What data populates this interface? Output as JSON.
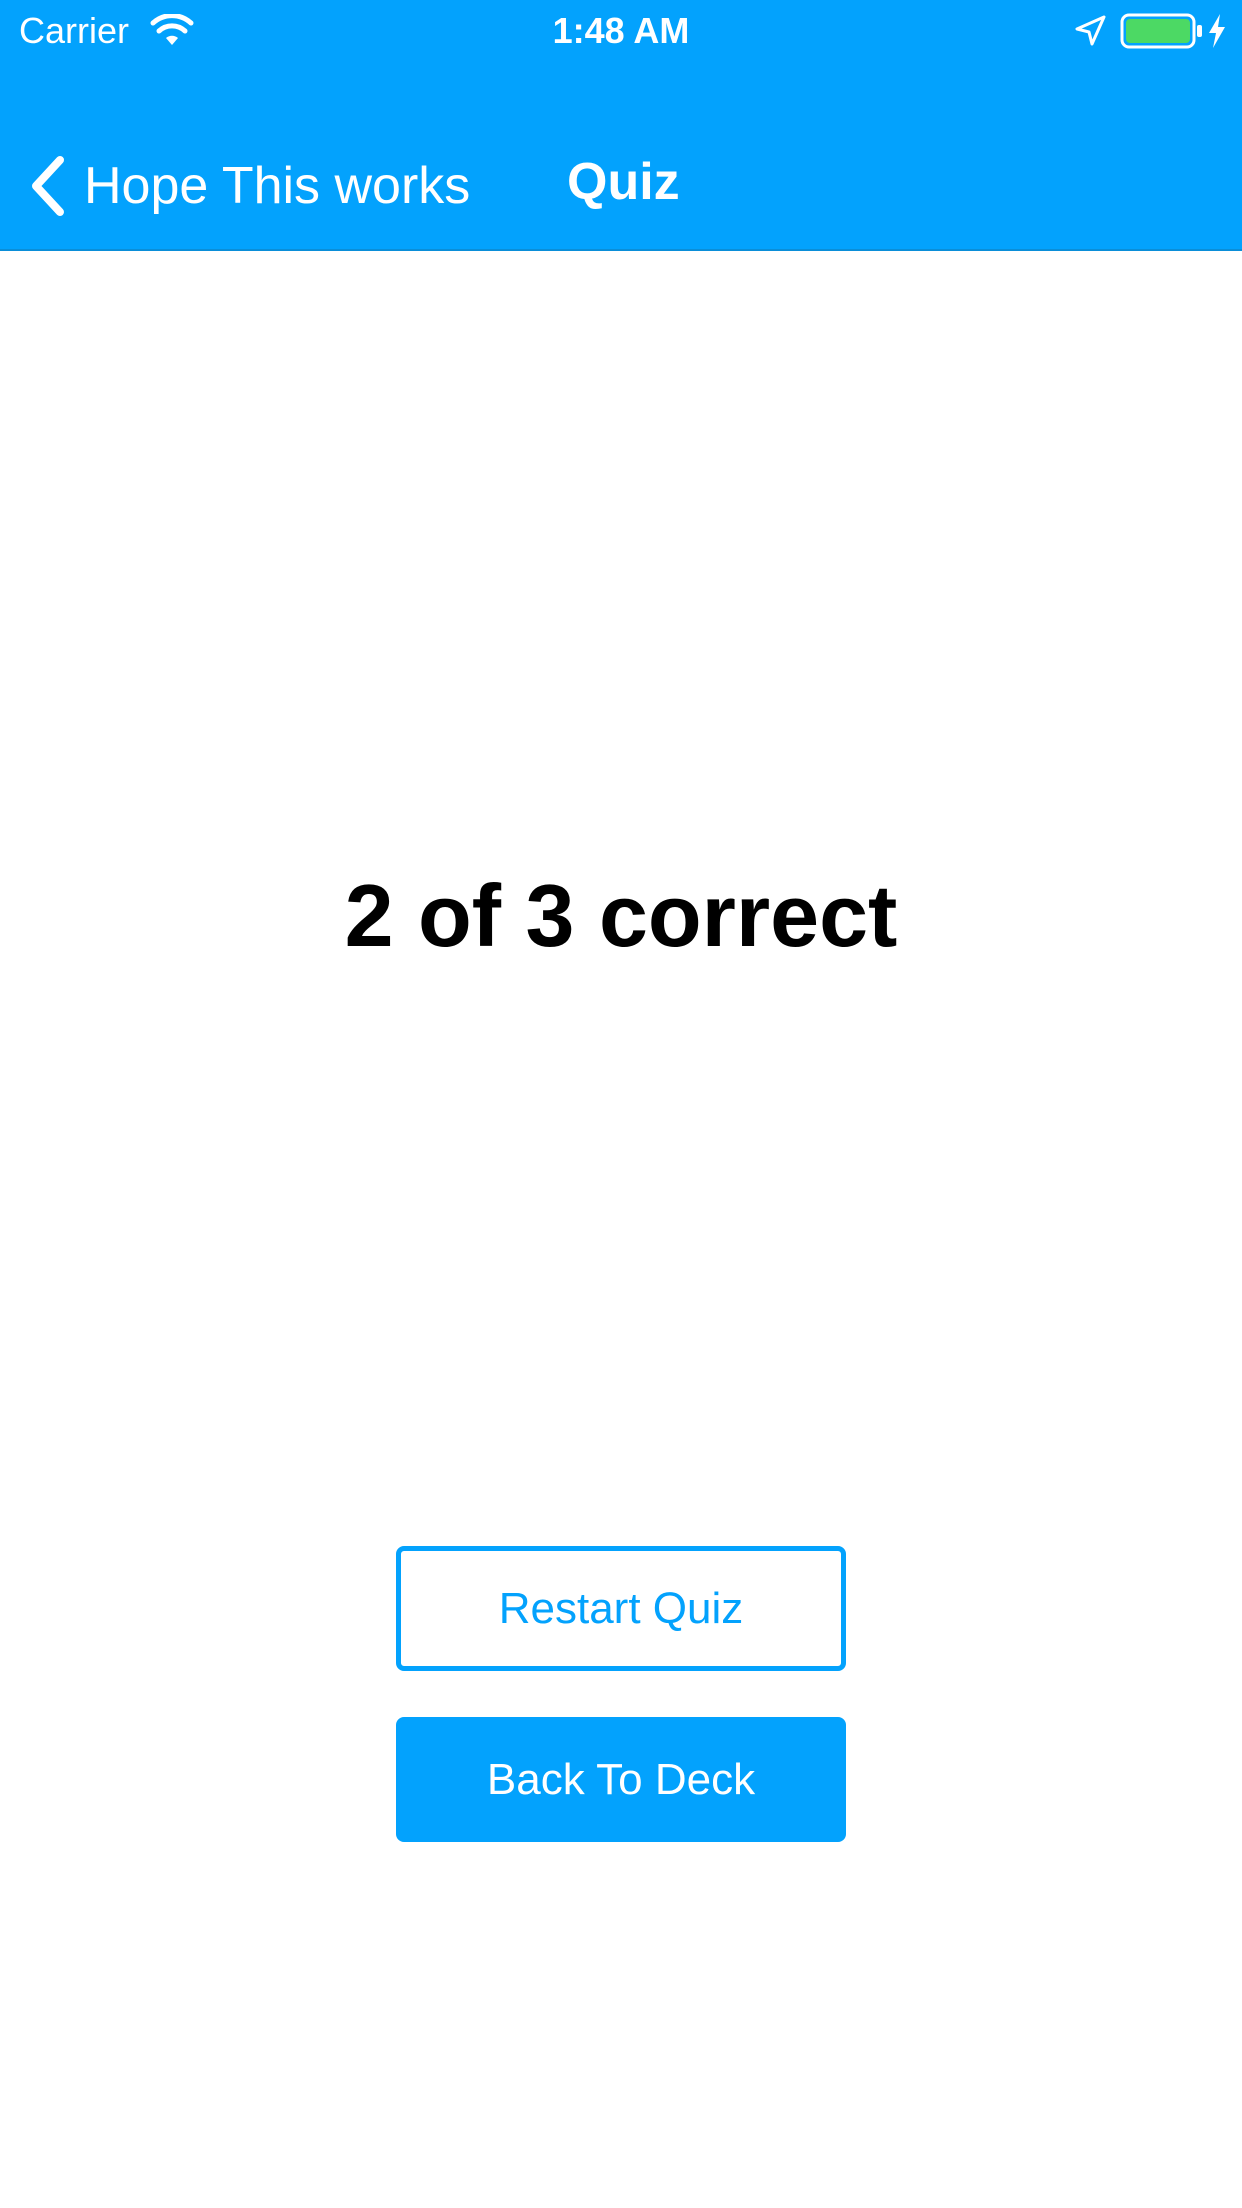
{
  "status_bar": {
    "carrier": "Carrier",
    "time": "1:48 AM",
    "icons": [
      "wifi-icon",
      "location-arrow-icon",
      "battery-icon",
      "charging-bolt-icon"
    ]
  },
  "nav": {
    "back_label": "Hope This works",
    "title": "Quiz"
  },
  "result": {
    "score_text": "2 of 3 correct"
  },
  "actions": {
    "restart_label": "Restart Quiz",
    "back_to_deck_label": "Back To Deck"
  },
  "colors": {
    "accent": "#03A2FD",
    "background": "#FFFFFF",
    "text": "#000000",
    "battery_fill": "#4CD964"
  }
}
